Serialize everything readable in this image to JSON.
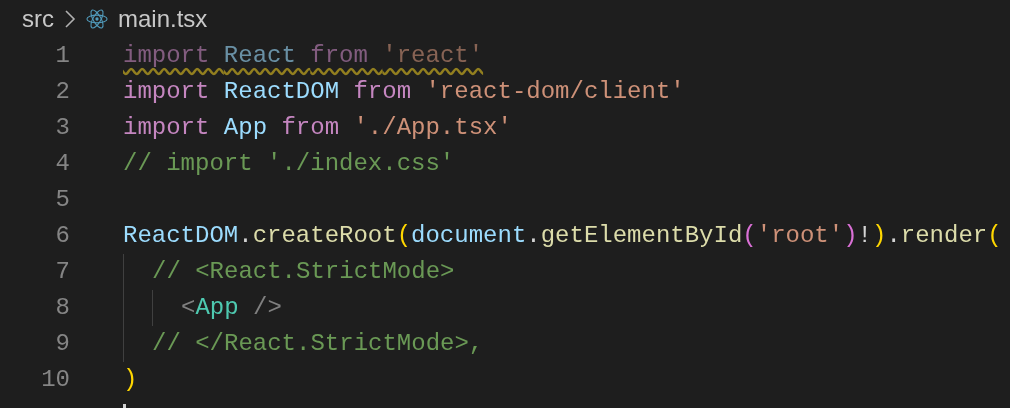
{
  "breadcrumb": [
    {
      "label": "src",
      "kind": "folder"
    },
    {
      "label": "main.tsx",
      "kind": "react-file"
    }
  ],
  "lines": [
    {
      "number": "1",
      "faded": true,
      "warning": true,
      "tokens": [
        {
          "kind": "keyword",
          "text": "import "
        },
        {
          "kind": "variable",
          "text": "React "
        },
        {
          "kind": "keyword",
          "text": "from "
        },
        {
          "kind": "string",
          "text": "'react'"
        }
      ]
    },
    {
      "number": "2",
      "tokens": [
        {
          "kind": "keyword",
          "text": "import "
        },
        {
          "kind": "variable",
          "text": "ReactDOM "
        },
        {
          "kind": "keyword",
          "text": "from "
        },
        {
          "kind": "string",
          "text": "'react-dom/client'"
        }
      ]
    },
    {
      "number": "3",
      "tokens": [
        {
          "kind": "keyword",
          "text": "import "
        },
        {
          "kind": "variable",
          "text": "App "
        },
        {
          "kind": "keyword",
          "text": "from "
        },
        {
          "kind": "string",
          "text": "'./App.tsx'"
        }
      ]
    },
    {
      "number": "4",
      "tokens": [
        {
          "kind": "comment",
          "text": "// import './index.css'"
        }
      ]
    },
    {
      "number": "5"
    },
    {
      "number": "6",
      "tokens": [
        {
          "kind": "variable",
          "text": "ReactDOM"
        },
        {
          "kind": "plain",
          "text": "."
        },
        {
          "kind": "function",
          "text": "createRoot"
        },
        {
          "kind": "bracket",
          "text": "("
        },
        {
          "kind": "variable",
          "text": "document"
        },
        {
          "kind": "plain",
          "text": "."
        },
        {
          "kind": "function",
          "text": "getElementById"
        },
        {
          "kind": "bracket2",
          "text": "("
        },
        {
          "kind": "string",
          "text": "'root'"
        },
        {
          "kind": "bracket2",
          "text": ")"
        },
        {
          "kind": "plain",
          "text": "!"
        },
        {
          "kind": "bracket",
          "text": ")"
        },
        {
          "kind": "plain",
          "text": "."
        },
        {
          "kind": "function",
          "text": "render"
        },
        {
          "kind": "bracket",
          "text": "("
        }
      ],
      "children": [
        {
          "number": "7",
          "tokens": [
            {
              "kind": "comment",
              "text": "// <React.StrictMode>"
            }
          ],
          "children": [
            {
              "number": "8",
              "tokens": [
                {
                  "kind": "tag-bracket",
                  "text": "<"
                },
                {
                  "kind": "tag",
                  "text": "App"
                },
                {
                  "kind": "tag-bracket",
                  "text": " />"
                }
              ]
            }
          ]
        },
        {
          "number": "9",
          "tokens": [
            {
              "kind": "comment",
              "text": "// </React.StrictMode>,"
            }
          ]
        }
      ]
    },
    {
      "number": "10",
      "tokens": [
        {
          "kind": "bracket",
          "text": ")"
        }
      ]
    },
    {
      "cursor": true
    }
  ]
}
